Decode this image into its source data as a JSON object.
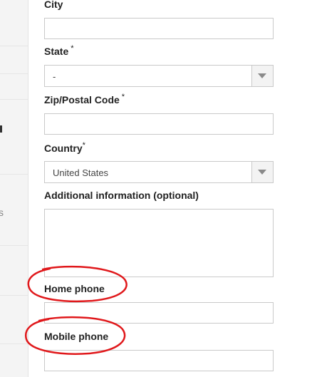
{
  "form": {
    "city": {
      "label": "City",
      "value": ""
    },
    "state": {
      "label": "State",
      "required_mark": "*",
      "value": "-"
    },
    "zip": {
      "label": "Zip/Postal Code",
      "required_mark": "*",
      "value": ""
    },
    "country": {
      "label": "Country",
      "required_mark": "*",
      "value": "United States"
    },
    "additional_info": {
      "label": "Additional information (optional)",
      "value": ""
    },
    "home_phone": {
      "label": "Home phone",
      "value": ""
    },
    "mobile_phone": {
      "label": "Mobile phone",
      "value": ""
    }
  },
  "left_panel": {
    "glyph": "s"
  },
  "annotation": {
    "color": "#e0181b",
    "circled_fields": [
      "Home phone",
      "Mobile phone"
    ]
  },
  "icons": {
    "dropdown": "chevron-down-icon"
  }
}
